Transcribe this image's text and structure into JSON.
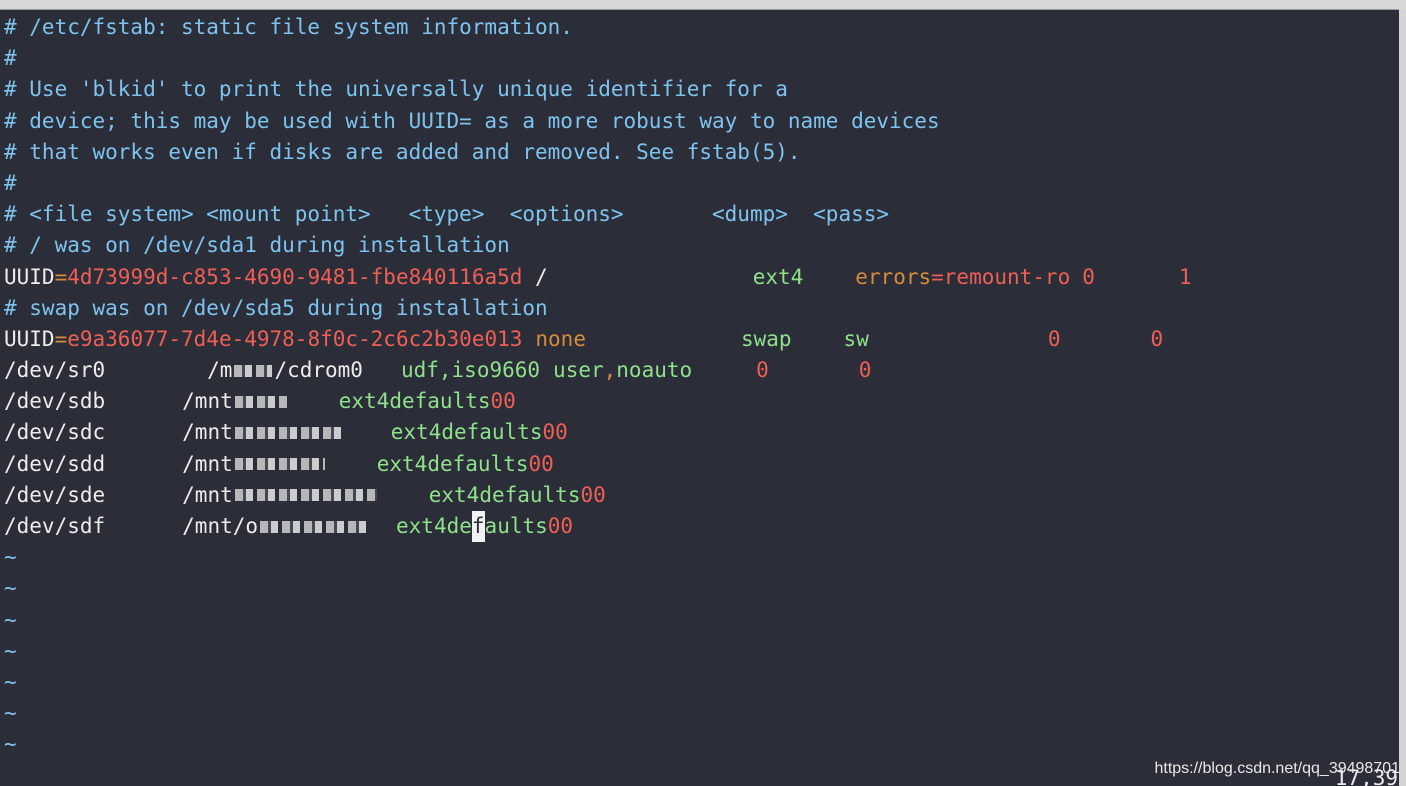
{
  "colors": {
    "background": "#2b2e38",
    "comment": "#7ec3ee",
    "keyword": "#ececec",
    "uuid_value": "#ef5f55",
    "option_value": "#d58c3b",
    "type_value": "#8fe08a"
  },
  "file": {
    "comments": [
      "# /etc/fstab: static file system information.",
      "#",
      "# Use 'blkid' to print the universally unique identifier for a",
      "# device; this may be used with UUID= as a more robust way to name devices",
      "# that works even if disks are added and removed. See fstab(5).",
      "#",
      "# <file system> <mount point>   <type>  <options>       <dump>  <pass>",
      "# / was on /dev/sda1 during installation",
      "# swap was on /dev/sda5 during installation"
    ],
    "uuid_root": {
      "key": "UUID",
      "eq": "=",
      "value": "4d73999d-c853-4690-9481-fbe840116a5d",
      "mount": " /",
      "type": "ext4",
      "options_key": "errors",
      "options_eq": "=",
      "options_value": "remount-ro",
      "dump": "0",
      "pass": "1"
    },
    "uuid_swap": {
      "key": "UUID",
      "eq": "=",
      "value": "e9a36077-7d4e-4978-8f0c-2c6c2b30e013",
      "mount": "none",
      "type": "swap",
      "options": "sw",
      "dump": "0",
      "pass": "0"
    },
    "sr0": {
      "device": "/dev/sr0",
      "mount_start": "/m",
      "mount_end": "/cdrom0",
      "type": "udf,iso9660",
      "opt1": "user",
      "comma": ",",
      "opt2": "noauto",
      "dump": "0",
      "pass": "0"
    },
    "disks": [
      {
        "device": "/dev/sdb",
        "mount": "/mnt",
        "type": "ext4",
        "options": "defaults",
        "dump": "0",
        "pass": "0"
      },
      {
        "device": "/dev/sdc",
        "mount": "/mnt",
        "type": "ext4",
        "options": "defaults",
        "dump": "0",
        "pass": "0"
      },
      {
        "device": "/dev/sdd",
        "mount": "/mnt",
        "type": "ext4",
        "options": "defaults",
        "dump": "0",
        "pass": "0"
      },
      {
        "device": "/dev/sde",
        "mount": "/mnt",
        "type": "ext4",
        "options": "defaults",
        "dump": "0",
        "pass": "0"
      },
      {
        "device": "/dev/sdf",
        "mount": "/mnt/o",
        "type": "ext4",
        "options_pre": "de",
        "options_cursor": "f",
        "options_post": "aults",
        "dump": "0",
        "pass": "0"
      }
    ],
    "tilde": "~"
  },
  "status": {
    "position": "17,39"
  },
  "watermark": "https://blog.csdn.net/qq_39498701"
}
